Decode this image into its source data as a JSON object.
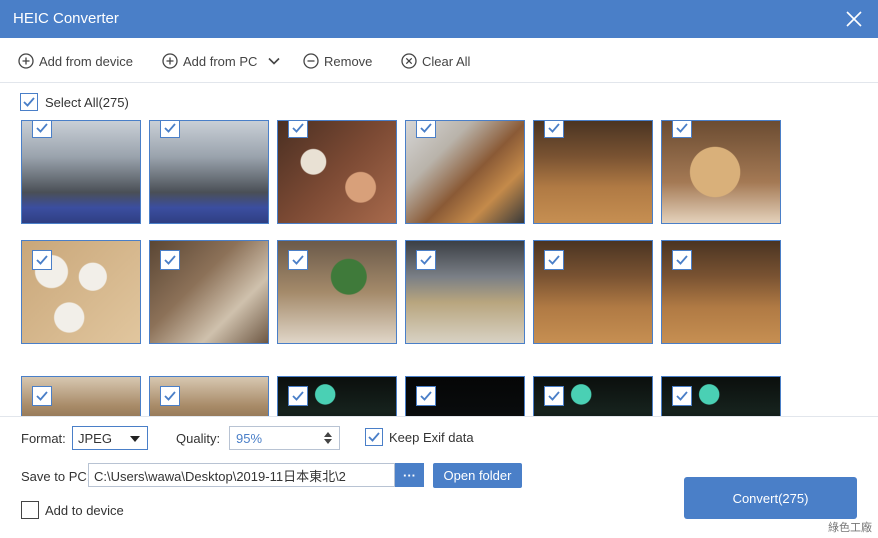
{
  "window": {
    "title": "HEIC Converter"
  },
  "toolbar": {
    "add_from_device": "Add from device",
    "add_from_pc": "Add from PC",
    "remove": "Remove",
    "clear_all": "Clear All"
  },
  "list": {
    "select_all_label": "Select All(275)",
    "select_all_checked": true,
    "thumbnails": [
      {
        "scene": "airport-terminal",
        "checked": true
      },
      {
        "scene": "airport-terminal",
        "checked": true
      },
      {
        "scene": "buffet-dishes",
        "checked": true
      },
      {
        "scene": "food-trays",
        "checked": true
      },
      {
        "scene": "restaurant-hall",
        "checked": true
      },
      {
        "scene": "cups-tray",
        "checked": true
      },
      {
        "scene": "soup-cups",
        "checked": true
      },
      {
        "scene": "buffet-counter",
        "checked": true
      },
      {
        "scene": "salad-bowls",
        "checked": true
      },
      {
        "scene": "chef-counter",
        "checked": true
      },
      {
        "scene": "restaurant-hall",
        "checked": true
      },
      {
        "scene": "restaurant-hall",
        "checked": true
      },
      {
        "scene": "restaurant-ceiling",
        "checked": true
      },
      {
        "scene": "restaurant-ceiling",
        "checked": true
      },
      {
        "scene": "night-building",
        "checked": true
      },
      {
        "scene": "night-dark",
        "checked": true
      },
      {
        "scene": "night-building",
        "checked": true
      },
      {
        "scene": "night-building",
        "checked": true
      }
    ]
  },
  "settings": {
    "format_label": "Format:",
    "format_value": "JPEG",
    "quality_label": "Quality:",
    "quality_value": "95%",
    "keep_exif_label": "Keep Exif data",
    "keep_exif_checked": true,
    "save_label": "Save to PC:",
    "save_path": "C:\\Users\\wawa\\Desktop\\2019-11日本東北\\2",
    "browse_label": "···",
    "open_folder_label": "Open folder",
    "add_to_device_label": "Add to device",
    "add_to_device_checked": false,
    "convert_label": "Convert(275)"
  },
  "watermark": "綠色工廠",
  "colors": {
    "accent": "#4a7fc8",
    "titlebar": "#4a7fc8"
  },
  "icons": {
    "close": "close-icon",
    "add": "plus-circle-icon",
    "remove": "minus-circle-icon",
    "clear": "x-circle-icon",
    "dropdown": "chevron-down-icon",
    "check": "checkmark-icon"
  }
}
